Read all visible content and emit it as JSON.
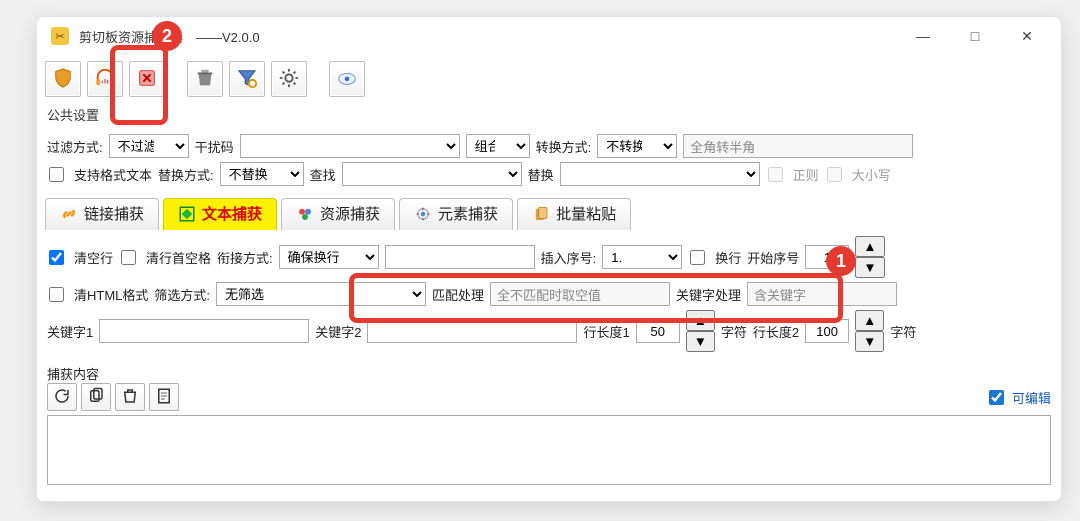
{
  "window": {
    "title": "剪切板资源捕获器　——V2.0.0",
    "section_title": "公共设置"
  },
  "winbuttons": {
    "min": "—",
    "max": "□",
    "close": "✕"
  },
  "toolbar_icons": [
    "shield",
    "headphones",
    "xfile",
    "trash",
    "funnel",
    "gear",
    "cloud"
  ],
  "row1": {
    "filter_label": "过滤方式:",
    "filter_selected": "不过滤",
    "noise_label": "干扰码",
    "combine_label": "组合",
    "convert_label": "转换方式:",
    "convert_selected": "不转换",
    "convert_hint": "全角转半角"
  },
  "row2": {
    "format_checkbox": "支持格式文本",
    "replace_label": "替换方式:",
    "replace_selected": "不替换",
    "find_label": "查找",
    "replace2_label": "替换",
    "regex_label": "正则",
    "case_label": "大小写"
  },
  "tabs": [
    {
      "key": "link",
      "label": "链接捕获"
    },
    {
      "key": "text",
      "label": "文本捕获"
    },
    {
      "key": "res",
      "label": "资源捕获"
    },
    {
      "key": "elem",
      "label": "元素捕获"
    },
    {
      "key": "batch",
      "label": "批量粘贴"
    }
  ],
  "text_row1": {
    "clear_blank": "清空行",
    "trim_leading": "清行首空格",
    "join_label": "衔接方式:",
    "join_selected": "确保换行",
    "insert_index": "插入序号:",
    "index_selected": "1.",
    "wrap_label": "换行",
    "start_index_label": "开始序号",
    "start_index_value": "1"
  },
  "text_row2": {
    "clear_html": "清HTML格式",
    "filter_label": "筛选方式:",
    "filter_selected": "无筛选",
    "match_label": "匹配处理",
    "match_selected": "全不匹配时取空值",
    "kw_proc_label": "关键字处理",
    "kw_proc_selected": "含关键字"
  },
  "text_row3": {
    "kw1_label": "关键字1",
    "kw2_label": "关键字2",
    "len1_label": "行长度1",
    "len1_value": "50",
    "char_label": "字符",
    "len2_label": "行长度2",
    "len2_value": "100"
  },
  "capture": {
    "label": "捕获内容",
    "editable_label": "可编辑"
  },
  "annotations": {
    "badge1": "1",
    "badge2": "2"
  }
}
